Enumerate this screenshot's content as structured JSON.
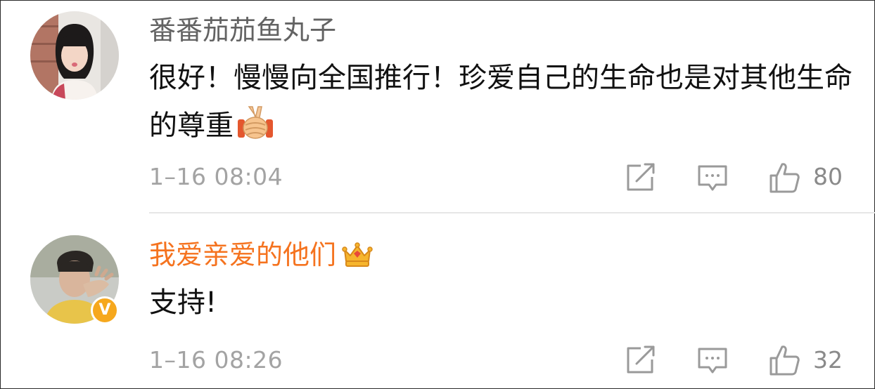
{
  "comments": [
    {
      "username": "番番茄茄鱼丸子",
      "text": "很好！慢慢向全国推行！珍爱自己的生命也是对其他生命的尊重",
      "emoji": "victory-handshake-emoji",
      "time": "1–16 08:04",
      "likes": "80",
      "username_color": "#636363"
    },
    {
      "username": "我爱亲爱的他们",
      "badge": "crown-badge",
      "verified": "V",
      "text": "支持!",
      "time": "1–16 08:26",
      "likes": "32",
      "username_color": "#f5731f"
    }
  ],
  "colors": {
    "meta_gray": "#a3a3a3",
    "verified_badge": "#f6a81d",
    "vip_name": "#f5731f"
  }
}
